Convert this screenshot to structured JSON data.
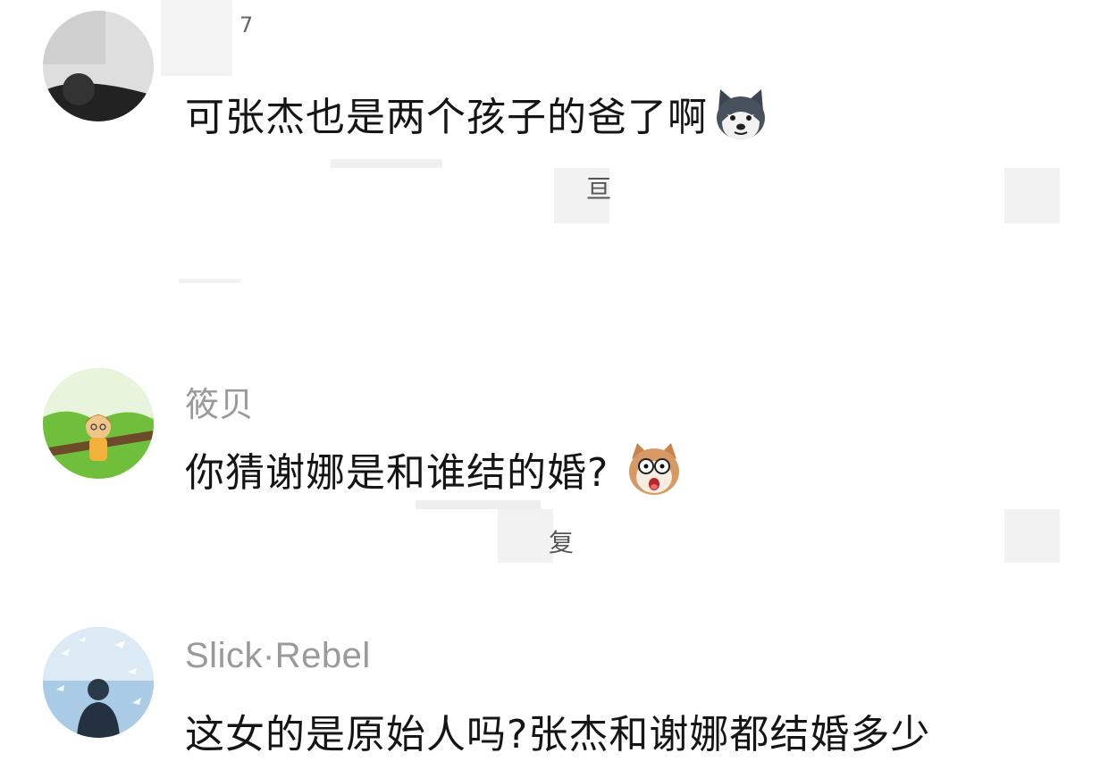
{
  "comments": [
    {
      "username_fragment": "7",
      "text": "可张杰也是两个孩子的爸了啊",
      "emoji": "husky-dog-icon",
      "meta_fragment": "亘"
    },
    {
      "username": "筱贝",
      "text": "你猜谢娜是和谁结的婚?",
      "emoji": "shocked-shiba-icon",
      "meta_fragment": "复"
    },
    {
      "username": "Slick·Rebel",
      "text": "这女的是原始人吗?张杰和谢娜都结婚多少"
    }
  ],
  "colors": {
    "username": "#9a9a9a",
    "text": "#151515",
    "background": "#ffffff",
    "redaction": "#eeeeee"
  }
}
